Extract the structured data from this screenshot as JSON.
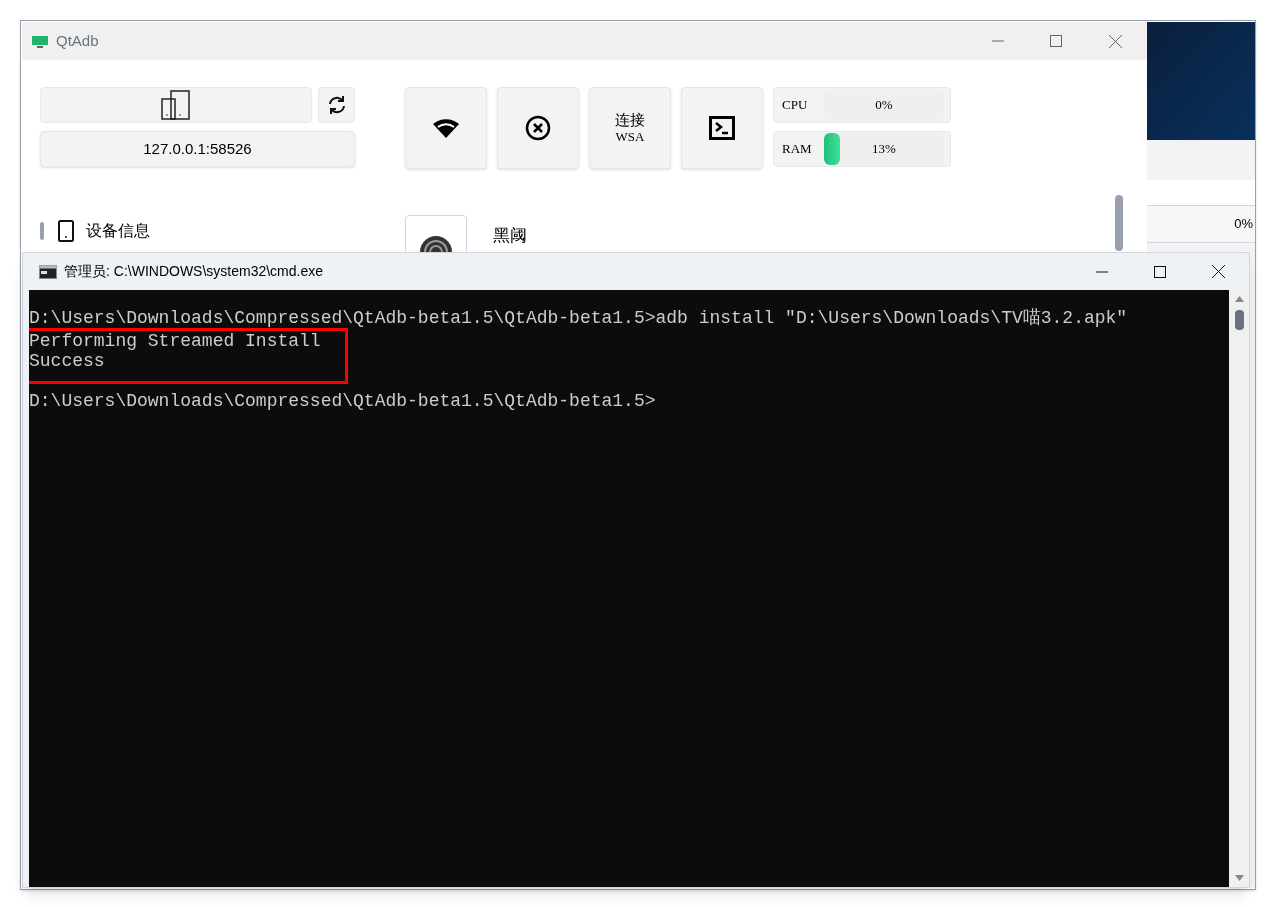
{
  "qtadb": {
    "title": "QtAdb",
    "address": "127.0.0.1:58526",
    "tools": [
      {
        "kind": "wifi"
      },
      {
        "kind": "disconnect"
      },
      {
        "kind": "text",
        "label": "连接",
        "sublabel": "WSA"
      },
      {
        "kind": "terminal"
      }
    ],
    "meters": [
      {
        "label": "CPU",
        "reading": "0%"
      },
      {
        "label": "RAM",
        "level": 0.13,
        "reading": "13%"
      }
    ],
    "section": "设备信息",
    "app": "黑阈"
  },
  "background_window": {
    "reading": "0%"
  },
  "cmd": {
    "title": "管理员: C:\\WINDOWS\\system32\\cmd.exe",
    "lines": [
      {
        "text": "D:\\Users\\Downloads\\Compressed\\QtAdb-beta1.5\\QtAdb-beta1.5>adb install \"D:\\Users\\Downloads\\TV喵3.2.apk\"",
        "highlighted": false,
        "blank_before": false
      },
      {
        "text": "Performing Streamed Install",
        "highlighted": true,
        "blank_before": false
      },
      {
        "text": "Success",
        "highlighted": true,
        "blank_before": false
      },
      {
        "text": "D:\\Users\\Downloads\\Compressed\\QtAdb-beta1.5\\QtAdb-beta1.5>",
        "highlighted": false,
        "blank_before": true
      }
    ]
  }
}
